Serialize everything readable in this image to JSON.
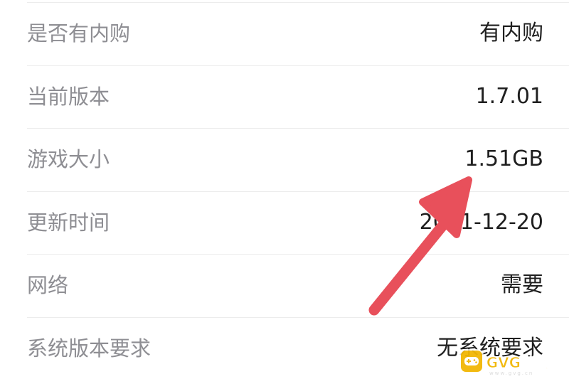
{
  "info_rows": [
    {
      "label": "是否有内购",
      "value": "有内购"
    },
    {
      "label": "当前版本",
      "value": "1.7.01"
    },
    {
      "label": "游戏大小",
      "value": "1.51GB"
    },
    {
      "label": "更新时间",
      "value": "2021-12-20"
    },
    {
      "label": "网络",
      "value": "需要"
    },
    {
      "label": "系统版本要求",
      "value": "无系统要求"
    }
  ],
  "annotation": {
    "arrow_color": "#e8505b",
    "points_to": "游戏大小"
  },
  "watermark": {
    "text": "GVG游戏网",
    "subtext": "www.gvg.cn",
    "color": "#f2b705",
    "icon": "gamepad-icon"
  }
}
